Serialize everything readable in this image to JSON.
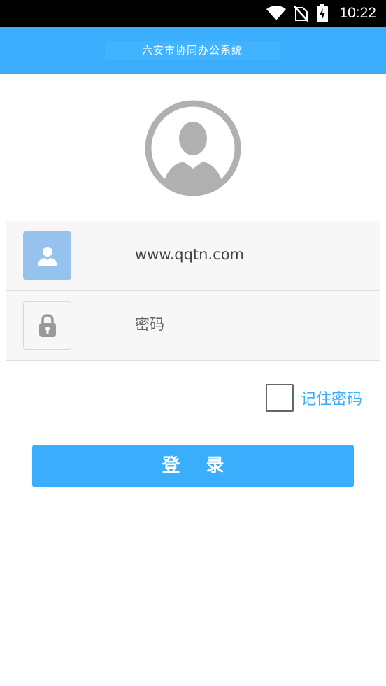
{
  "status_bar": {
    "time": "10:22",
    "icons": [
      "wifi-icon",
      "no-sim-icon",
      "battery-charging-icon"
    ]
  },
  "header": {
    "title": "六安市协同办公系统"
  },
  "form": {
    "username_value": "www.qqtn.com",
    "password_placeholder": "密码",
    "remember_label": "记住密码",
    "remember_checked": false,
    "login_label": "登 录"
  },
  "colors": {
    "accent": "#3aadfd",
    "user_icon_bg": "#96c3ee",
    "form_bg": "#f7f7f7"
  }
}
